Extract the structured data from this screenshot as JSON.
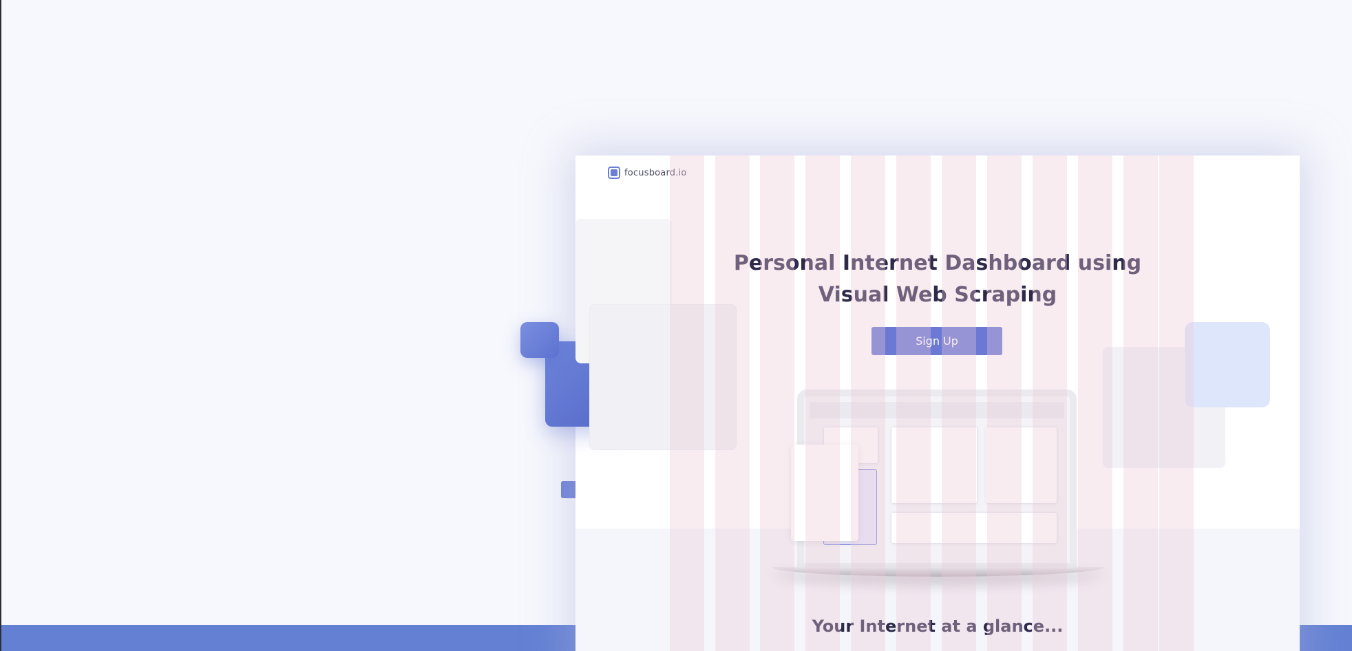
{
  "brand": {
    "name": "focusboard.io",
    "accent": "#6b79d4",
    "band_color": "#6380d3"
  },
  "hero": {
    "title_line1": "Personal Internet Dashboard using",
    "title_line2": "Visual Web Scraping",
    "cta_label": "Sign Up"
  },
  "section": {
    "heading": "Your Internet at a glance..."
  },
  "icons": {
    "logo": "focusboard-logo-icon"
  }
}
